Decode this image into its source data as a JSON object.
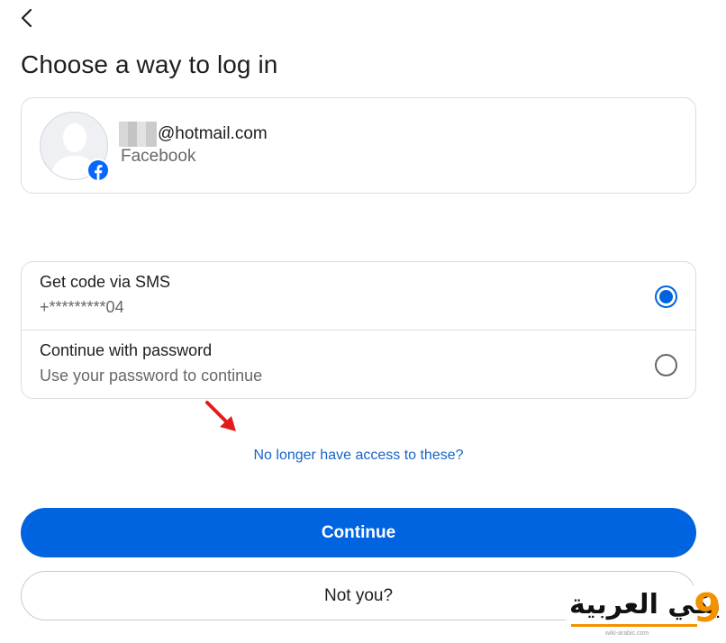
{
  "page": {
    "title": "Choose a way to log in"
  },
  "account": {
    "email_suffix": "@hotmail.com",
    "platform": "Facebook"
  },
  "options": [
    {
      "title": "Get code via SMS",
      "subtitle": "+*********04",
      "selected": true
    },
    {
      "title": "Continue with password",
      "subtitle": "Use your password to continue",
      "selected": false
    }
  ],
  "links": {
    "no_access": "No longer have access to these?"
  },
  "buttons": {
    "continue": "Continue",
    "not_you": "Not you?"
  },
  "watermark": {
    "text": "يكي العربية",
    "digit": "9",
    "url": "wiki-arabic.com"
  },
  "colors": {
    "primary": "#0064e0",
    "link": "#1665c8",
    "arrow": "#e31b1b",
    "watermark_accent": "#f39200"
  },
  "icons": {
    "back": "chevron-left-icon",
    "platform_badge": "facebook-icon",
    "avatar": "default-avatar-icon",
    "annotation": "red-arrow-icon"
  }
}
